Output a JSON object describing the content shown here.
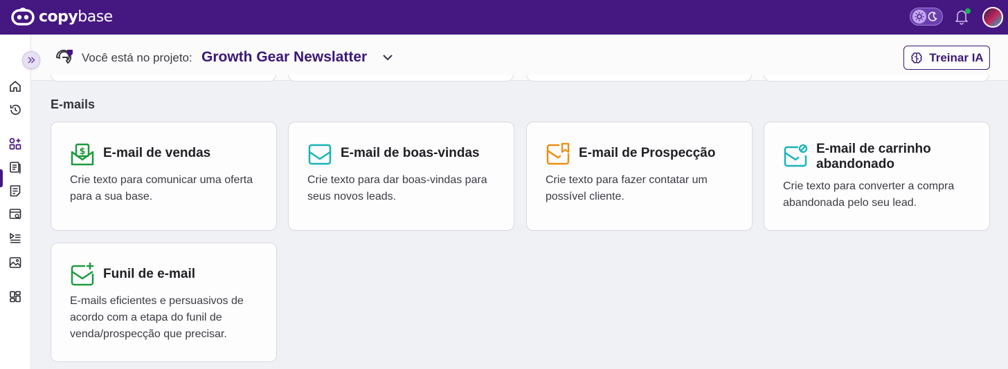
{
  "app": {
    "logo_text_bold": "copy",
    "logo_text_light": "base"
  },
  "header": {
    "theme_toggle": {
      "icons": [
        "sun-icon",
        "moon-icon"
      ]
    },
    "notifications": {
      "has_unread": true
    },
    "avatar": "avatar"
  },
  "project": {
    "label": "Você está no projeto:",
    "name": "Growth Gear Newslatter",
    "train_button": "Treinar IA"
  },
  "sidebar": {
    "items": [
      {
        "name": "home-icon",
        "active": false
      },
      {
        "name": "history-icon",
        "active": false
      },
      {
        "name": "templates-icon",
        "active": true
      },
      {
        "name": "documents-icon",
        "active": false
      },
      {
        "name": "notes-icon",
        "active": false
      },
      {
        "name": "web-page-icon",
        "active": false
      },
      {
        "name": "playlist-icon",
        "active": false
      },
      {
        "name": "image-icon",
        "active": false
      },
      {
        "name": "dashboard-icon",
        "active": false
      }
    ]
  },
  "section": {
    "title": "E-mails"
  },
  "cards": [
    {
      "title": "E-mail de vendas",
      "desc": "Crie texto para comunicar uma oferta para a sua base.",
      "icon": "money-mail-icon",
      "color": "#1f9a3c"
    },
    {
      "title": "E-mail de boas-vindas",
      "desc": "Crie texto para dar boas-vindas para seus novos leads.",
      "icon": "mail-open-icon",
      "color": "#18b3b8"
    },
    {
      "title": "E-mail de Prospecção",
      "desc": "Crie texto para fazer contatar um possível cliente.",
      "icon": "mail-bookmark-icon",
      "color": "#f08c12"
    },
    {
      "title": "E-mail de carrinho abandonado",
      "desc": "Crie texto para converter a compra abandonada pelo seu lead.",
      "icon": "mail-blocked-icon",
      "color": "#18b3b8"
    },
    {
      "title": "Funil de e-mail",
      "desc": "E-mails eficientes e persuasivos de acordo com a etapa do funil de venda/prospecção que precisar.",
      "icon": "mail-plus-icon",
      "color": "#1f9a3c"
    }
  ],
  "colors": {
    "brand": "#451780",
    "accent_text": "#3b1875",
    "background": "#f0f1f5"
  }
}
